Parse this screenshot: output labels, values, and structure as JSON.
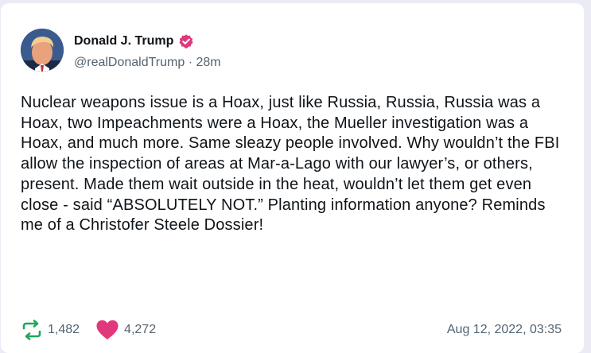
{
  "post": {
    "author": {
      "display_name": "Donald J. Trump",
      "handle": "@realDonaldTrump",
      "separator": "·",
      "age": "28m",
      "verified_icon": "verified-badge-icon"
    },
    "text": "Nuclear weapons issue is a Hoax, just like Russia, Russia, Russia was a Hoax, two Impeachments were a Hoax, the Mueller investigation was a Hoax, and much more. Same sleazy people involved. Why wouldn’t the FBI allow the inspection of areas at Mar-a-Lago with our lawyer’s, or others, present. Made them wait outside in the heat, wouldn’t let them get even close - said “ABSOLUTELY NOT.” Planting information anyone? Reminds me of a Christofer Steele Dossier!",
    "stats": {
      "reposts": "1,482",
      "likes": "4,272"
    },
    "timestamp": "Aug 12, 2022, 03:35"
  },
  "colors": {
    "verified": "#e0387a",
    "repost": "#1fa85a",
    "like": "#e0387a",
    "background": "#ebebf5"
  }
}
